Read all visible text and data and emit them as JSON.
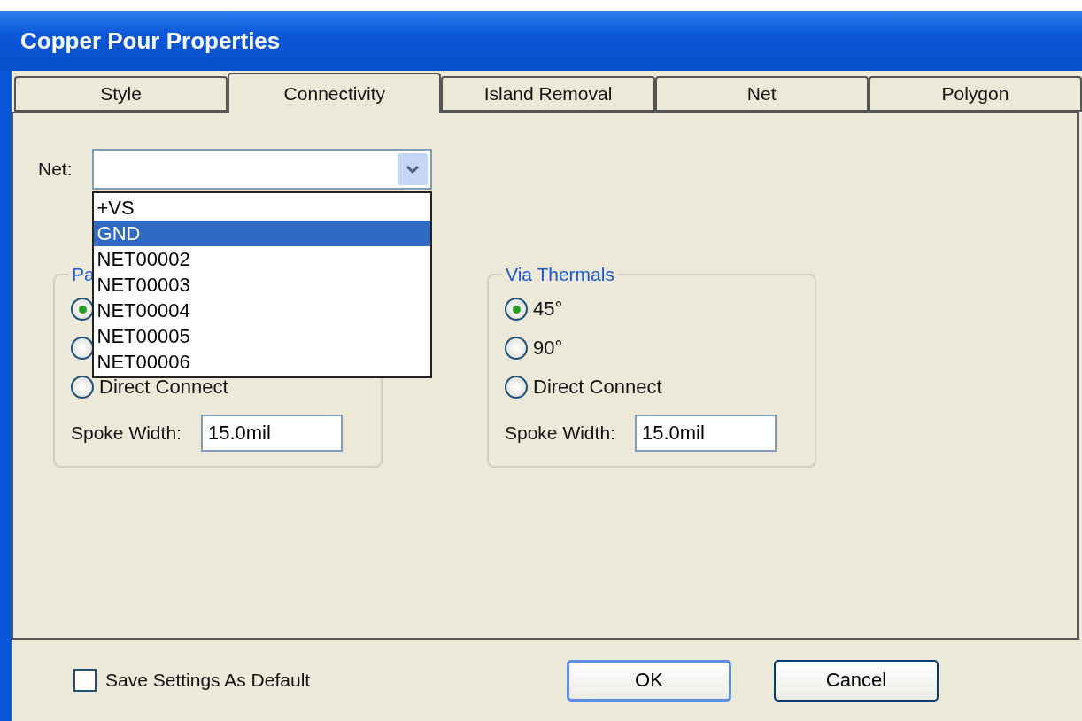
{
  "window": {
    "title": "Copper Pour Properties"
  },
  "tabs": [
    {
      "label": "Style",
      "selected": false
    },
    {
      "label": "Connectivity",
      "selected": true
    },
    {
      "label": "Island Removal",
      "selected": false
    },
    {
      "label": "Net",
      "selected": false
    },
    {
      "label": "Polygon",
      "selected": false
    }
  ],
  "net": {
    "label": "Net:",
    "expanded": true,
    "options": [
      {
        "label": "+VS",
        "selected": false
      },
      {
        "label": "GND",
        "selected": true
      },
      {
        "label": "NET00002",
        "selected": false
      },
      {
        "label": "NET00003",
        "selected": false
      },
      {
        "label": "NET00004",
        "selected": false
      },
      {
        "label": "NET00005",
        "selected": false
      },
      {
        "label": "NET00006",
        "selected": false
      }
    ]
  },
  "groups": [
    {
      "title": "Pa",
      "options": [
        {
          "selected": true
        },
        {
          "selected": false
        },
        {
          "label": "Direct Connect",
          "selected": false
        }
      ],
      "spoke_label": "Spoke Width:",
      "spoke_value": "15.0mil"
    },
    {
      "title": "Via Thermals",
      "options": [
        {
          "label": "45°",
          "selected": true
        },
        {
          "label": "90°",
          "selected": false
        },
        {
          "label": "Direct Connect",
          "selected": false
        }
      ],
      "spoke_label": "Spoke Width:",
      "spoke_value": "15.0mil"
    }
  ],
  "save_default": {
    "label": "Save Settings As Default",
    "checked": false
  },
  "buttons": [
    {
      "label": "OK",
      "default": true
    },
    {
      "label": "Cancel",
      "default": false
    }
  ]
}
